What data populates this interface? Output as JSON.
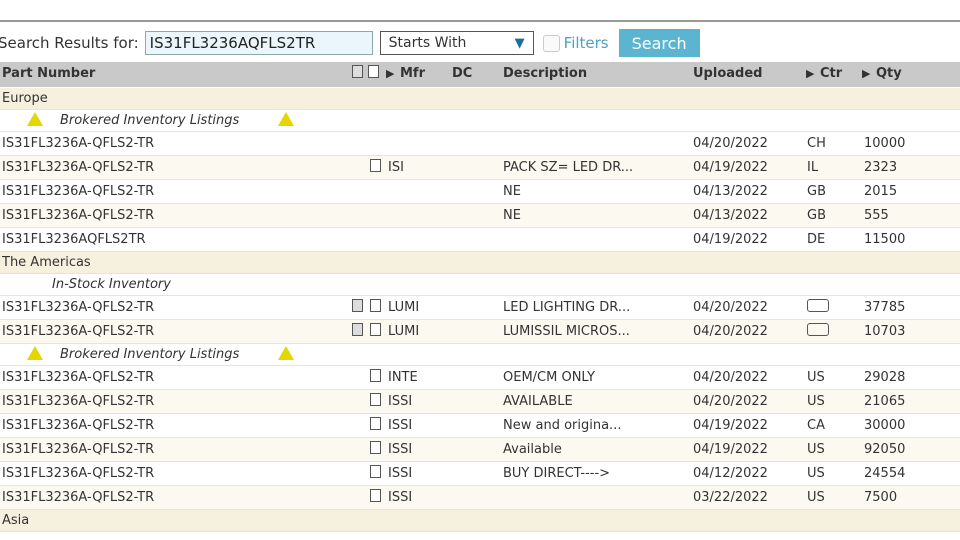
{
  "search": {
    "label": "Search Results for:",
    "query": "IS31FL3236AQFLS2TR",
    "mode": "Starts With",
    "filters_label": "Filters",
    "filters_checked": false,
    "button": "Search"
  },
  "columns": {
    "part": "Part Number",
    "mfr": "Mfr",
    "dc": "DC",
    "desc": "Description",
    "uploaded": "Uploaded",
    "ctr": "Ctr",
    "qty": "Qty"
  },
  "rows": [
    {
      "type": "region",
      "label": "Europe"
    },
    {
      "type": "section",
      "label": "Brokered Inventory Listings",
      "warn": true
    },
    {
      "part": "IS31FL3236A-QFLS2-TR",
      "mfr": "",
      "desc": "",
      "date": "04/20/2022",
      "ctr": "CH",
      "qty": "10000"
    },
    {
      "part": "IS31FL3236A-QFLS2-TR",
      "doc": true,
      "mfr": "ISI",
      "desc": "PACK SZ= LED DR...",
      "date": "04/19/2022",
      "ctr": "IL",
      "qty": "2323"
    },
    {
      "part": "IS31FL3236A-QFLS2-TR",
      "mfr": "",
      "desc": "NE",
      "date": "04/13/2022",
      "ctr": "GB",
      "qty": "2015"
    },
    {
      "part": "IS31FL3236A-QFLS2-TR",
      "mfr": "",
      "desc": "NE",
      "date": "04/13/2022",
      "ctr": "GB",
      "qty": "555"
    },
    {
      "part": "IS31FL3236AQFLS2TR",
      "mfr": "",
      "desc": "",
      "date": "04/19/2022",
      "ctr": "DE",
      "qty": "11500"
    },
    {
      "type": "region",
      "label": "The Americas"
    },
    {
      "type": "section",
      "label": "In-Stock Inventory",
      "warn": false
    },
    {
      "part": "IS31FL3236A-QFLS2-TR",
      "ds": true,
      "doc": true,
      "mfr": "LUMI",
      "desc": "LED LIGHTING DR...",
      "date": "04/20/2022",
      "ctr": "",
      "flag": true,
      "qty": "37785"
    },
    {
      "part": "IS31FL3236A-QFLS2-TR",
      "ds": true,
      "doc": true,
      "mfr": "LUMI",
      "desc": "LUMISSIL MICROS...",
      "date": "04/20/2022",
      "ctr": "",
      "flag": true,
      "qty": "10703"
    },
    {
      "type": "section",
      "label": "Brokered Inventory Listings",
      "warn": true
    },
    {
      "part": "IS31FL3236A-QFLS2-TR",
      "doc": true,
      "mfr": "INTE",
      "desc": "OEM/CM ONLY",
      "date": "04/20/2022",
      "ctr": "US",
      "qty": "29028"
    },
    {
      "part": "IS31FL3236A-QFLS2-TR",
      "doc": true,
      "mfr": "ISSI",
      "desc": "AVAILABLE",
      "date": "04/20/2022",
      "ctr": "US",
      "qty": "21065"
    },
    {
      "part": "IS31FL3236A-QFLS2-TR",
      "doc": true,
      "mfr": "ISSI",
      "desc": "New and origina...",
      "date": "04/19/2022",
      "ctr": "CA",
      "qty": "30000"
    },
    {
      "part": "IS31FL3236A-QFLS2-TR",
      "doc": true,
      "mfr": "ISSI",
      "desc": "Available",
      "date": "04/19/2022",
      "ctr": "US",
      "qty": "92050"
    },
    {
      "part": "IS31FL3236A-QFLS2-TR",
      "doc": true,
      "mfr": "ISSI",
      "desc": "BUY DIRECT---->",
      "date": "04/12/2022",
      "ctr": "US",
      "qty": "24554"
    },
    {
      "part": "IS31FL3236A-QFLS2-TR",
      "doc": true,
      "mfr": "ISSI",
      "desc": "",
      "date": "03/22/2022",
      "ctr": "US",
      "qty": "7500"
    },
    {
      "type": "region",
      "label": "Asia"
    }
  ]
}
